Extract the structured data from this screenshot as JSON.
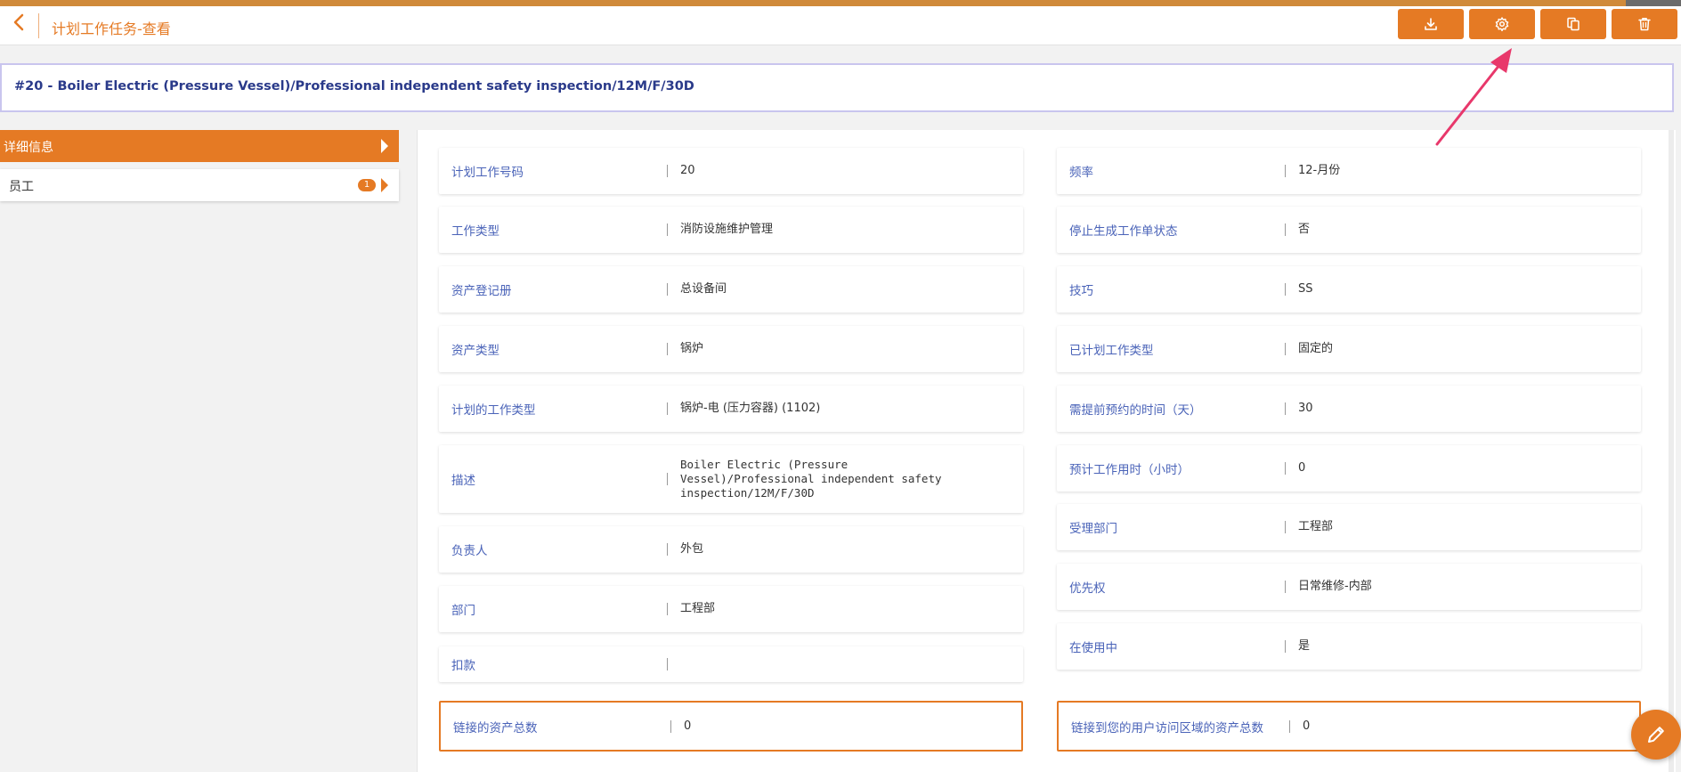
{
  "header": {
    "back_icon": "chevron-left-icon",
    "title": "计划工作任务-查看",
    "toolbar": [
      {
        "name": "download-button",
        "icon": "download-icon"
      },
      {
        "name": "settings-button",
        "icon": "gear-icon"
      },
      {
        "name": "copy-button",
        "icon": "copy-icon"
      },
      {
        "name": "delete-button",
        "icon": "trash-icon"
      }
    ]
  },
  "record": {
    "title": "#20 - Boiler Electric (Pressure Vessel)/Professional independent safety inspection/12M/F/30D"
  },
  "sidebar": {
    "items": [
      {
        "label": "详细信息",
        "active": true
      },
      {
        "label": "员工",
        "badge": "1",
        "active": false
      }
    ]
  },
  "fields_left": [
    {
      "label": "计划工作号码",
      "value": "20"
    },
    {
      "label": "工作类型",
      "value": "消防设施维护管理"
    },
    {
      "label": "资产登记册",
      "value": "总设备间"
    },
    {
      "label": "资产类型",
      "value": "锅炉"
    },
    {
      "label": "计划的工作类型",
      "value": "锅炉-电 (压力容器) (1102)"
    },
    {
      "label": "描述",
      "value": "Boiler Electric (Pressure Vessel)/Professional independent safety inspection/12M/F/30D"
    },
    {
      "label": "负责人",
      "value": "外包"
    },
    {
      "label": "部门",
      "value": "工程部"
    },
    {
      "label": "扣款",
      "value": ""
    },
    {
      "label": "链接的资产总数",
      "value": "0"
    }
  ],
  "fields_right": [
    {
      "label": "频率",
      "value": "12-月份"
    },
    {
      "label": "停止生成工作单状态",
      "value": "否"
    },
    {
      "label": "技巧",
      "value": "SS"
    },
    {
      "label": "已计划工作类型",
      "value": "固定的"
    },
    {
      "label": "需提前预约的时间（天）",
      "value": "30"
    },
    {
      "label": "预计工作用时（小时）",
      "value": "0"
    },
    {
      "label": "受理部门",
      "value": "工程部"
    },
    {
      "label": "优先权",
      "value": "日常维修-内部"
    },
    {
      "label": "在使用中",
      "value": "是"
    },
    {
      "label": "链接到您的用户访问区域的资产总数",
      "value": "0"
    }
  ],
  "colors": {
    "accent": "#e57a24",
    "label_blue": "#4a63b8",
    "record_title": "#2a3a8a",
    "annotation_arrow": "#e8386b"
  },
  "fab": {
    "icon": "pencil-icon"
  }
}
